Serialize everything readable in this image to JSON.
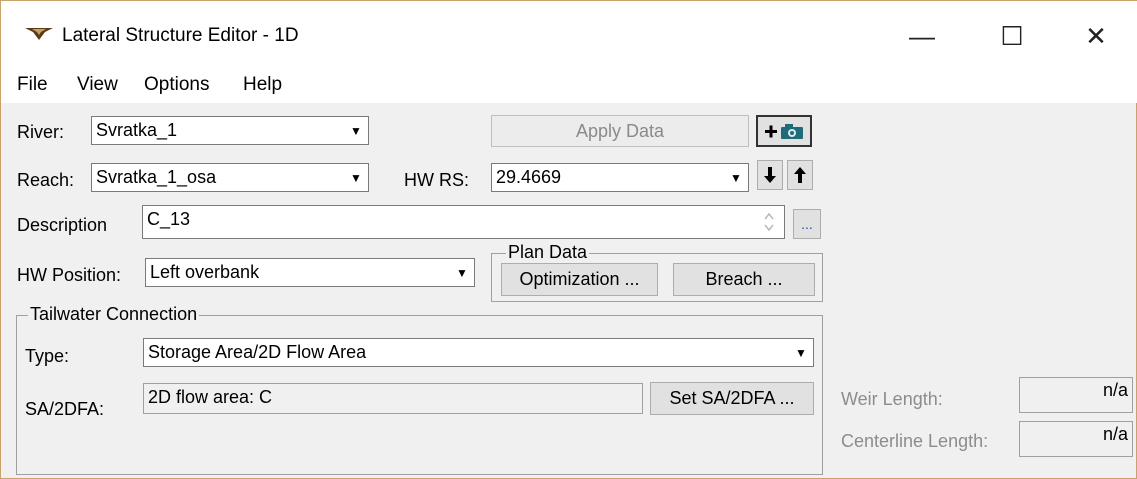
{
  "window": {
    "title": "Lateral Structure Editor - 1D",
    "minimize": "—",
    "maximize": "☐",
    "close": "✕"
  },
  "menu": {
    "file": "File",
    "view": "View",
    "options": "Options",
    "help": "Help"
  },
  "river": {
    "label": "River:",
    "value": "Svratka_1"
  },
  "reach": {
    "label": "Reach:",
    "value": "Svratka_1_osa"
  },
  "apply_data": "Apply Data",
  "hwrs": {
    "label": "HW RS:",
    "value": "29.4669"
  },
  "description": {
    "label": "Description",
    "value": "C_13",
    "ellipsis": "..."
  },
  "hw_position": {
    "label": "HW Position:",
    "value": "Left overbank"
  },
  "plan_data": {
    "title": "Plan Data",
    "optimization": "Optimization ...",
    "breach": "Breach ..."
  },
  "tailwater": {
    "title": "Tailwater Connection",
    "type_label": "Type:",
    "type_value": "Storage Area/2D Flow Area",
    "sa_label": "SA/2DFA:",
    "sa_value": "2D flow area: C",
    "set_button": "Set SA/2DFA ..."
  },
  "weir_length": {
    "label": "Weir Length:",
    "value": "n/a"
  },
  "centerline_length": {
    "label": "Centerline Length:",
    "value": "n/a"
  }
}
